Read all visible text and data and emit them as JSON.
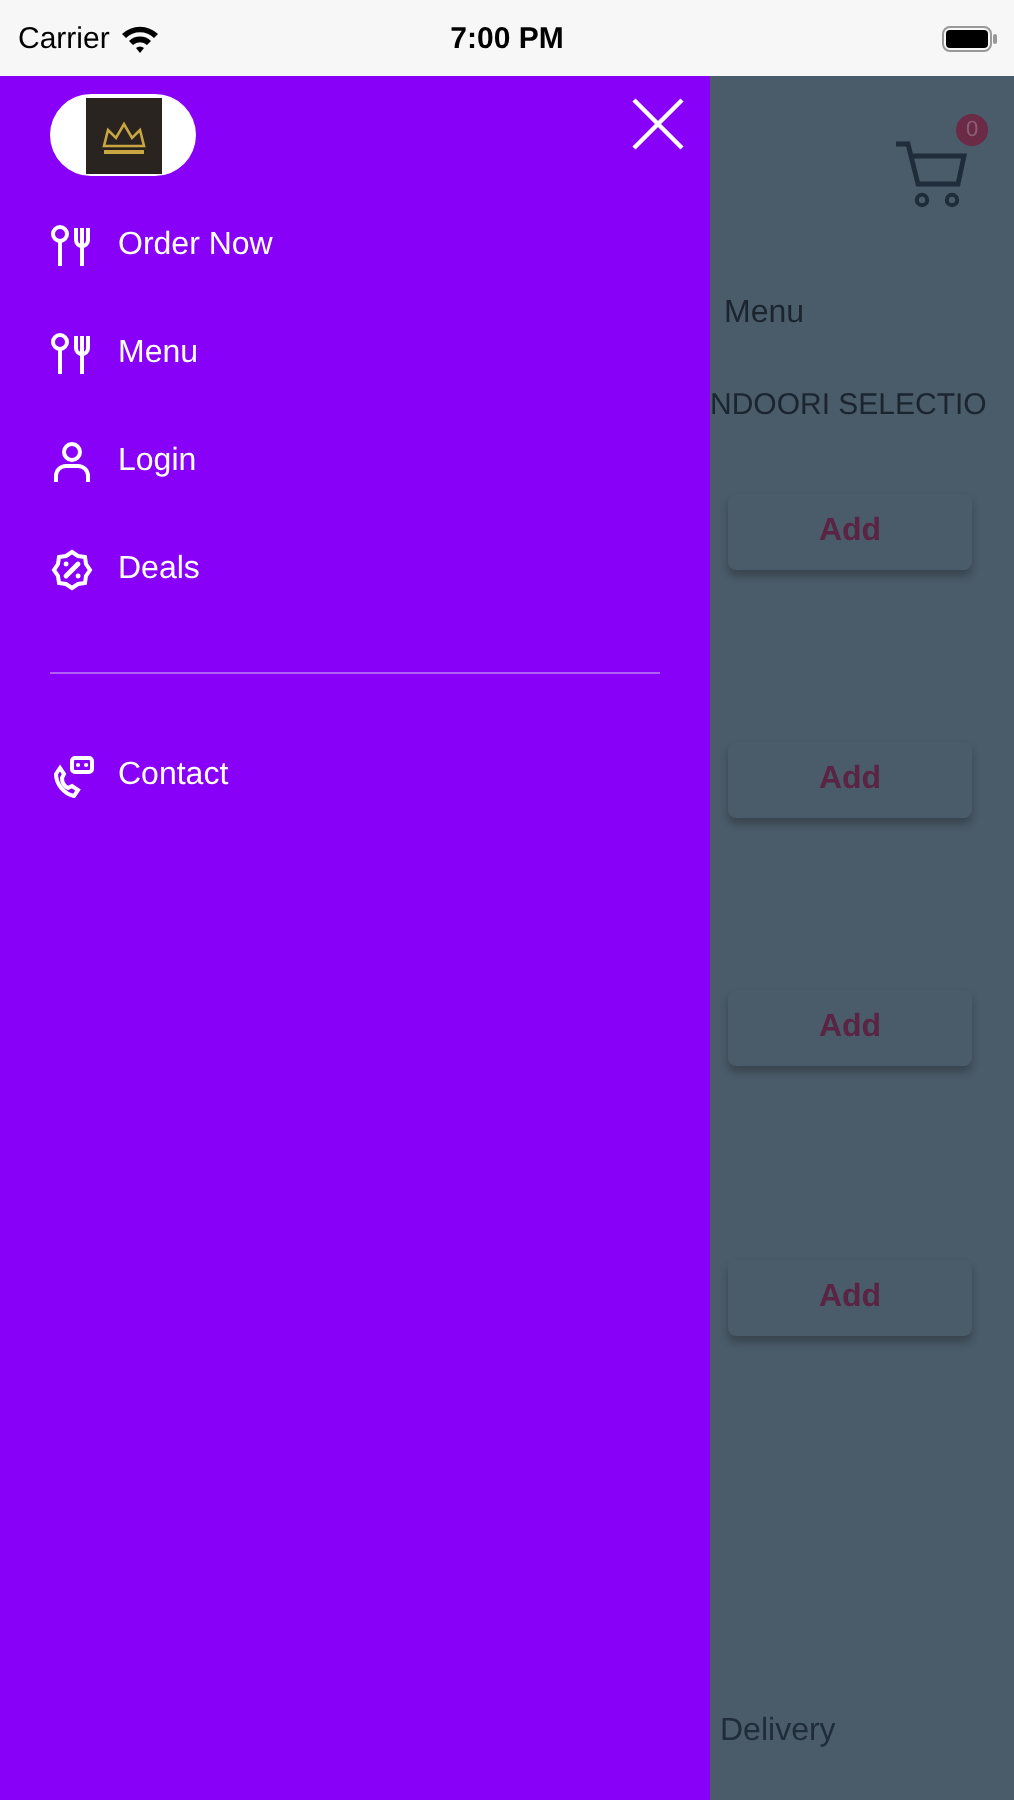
{
  "status_bar": {
    "carrier": "Carrier",
    "time": "7:00 PM"
  },
  "drawer": {
    "items": [
      {
        "label": "Order Now",
        "kind": "utensils"
      },
      {
        "label": "Menu",
        "kind": "utensils"
      },
      {
        "label": "Login",
        "kind": "user"
      },
      {
        "label": "Deals",
        "kind": "discount"
      }
    ],
    "secondary_items": [
      {
        "label": "Contact",
        "kind": "contact"
      }
    ]
  },
  "background": {
    "cart_count": "0",
    "search_label": "Menu",
    "category": "NDOORI SELECTIO",
    "add_buttons": [
      "Add",
      "Add",
      "Add",
      "Add"
    ],
    "footer": "Delivery"
  }
}
